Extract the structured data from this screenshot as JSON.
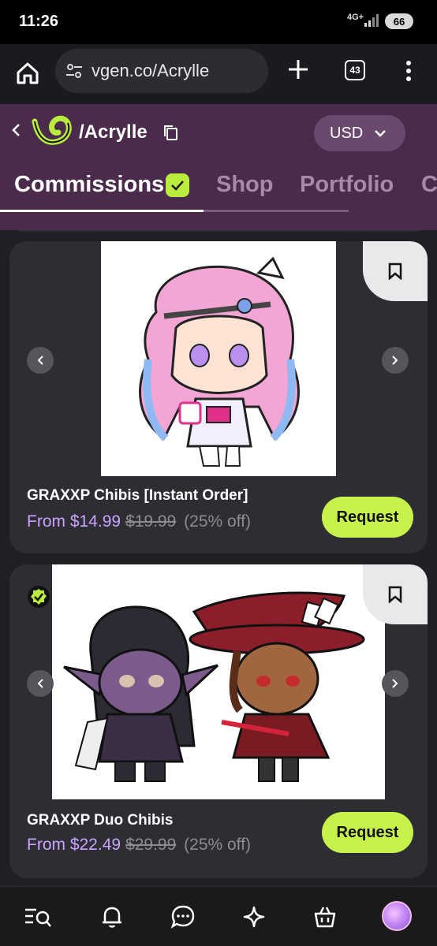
{
  "status_bar": {
    "time": "11:26",
    "network": "4G+",
    "battery": "66"
  },
  "browser": {
    "url": "vgen.co/Acrylle",
    "tab_count": "43"
  },
  "header": {
    "handle": "/Acrylle",
    "currency": "USD"
  },
  "tabs": [
    {
      "label": "Commissions",
      "active": true
    },
    {
      "label": "Shop",
      "active": false
    },
    {
      "label": "Portfolio",
      "active": false
    },
    {
      "label": "C",
      "active": false
    }
  ],
  "listings": [
    {
      "title": "GRAXXP Chibis [Instant Order]",
      "price": "From $14.99",
      "original_price": "$19.99",
      "discount": "(25% off)",
      "button": "Request"
    },
    {
      "title": "GRAXXP Duo Chibis",
      "price": "From $22.49",
      "original_price": "$29.99",
      "discount": "(25% off)",
      "button": "Request"
    }
  ],
  "bottom_nav": [
    "search-icon",
    "bell-icon",
    "chat-icon",
    "sparkle-icon",
    "shopping-bag-icon",
    "avatar"
  ],
  "colors": {
    "accent": "#c6f24a",
    "header_bg": "#4a2b4c",
    "price": "#c9a4ff",
    "card_bg": "#2d2d33"
  }
}
